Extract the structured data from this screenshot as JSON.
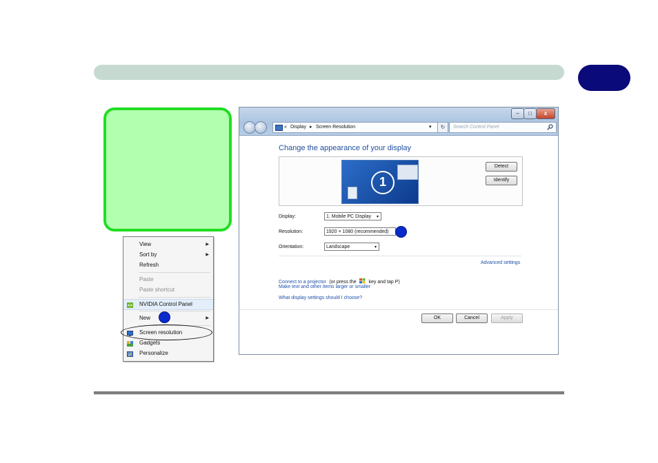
{
  "context_menu": {
    "items": [
      {
        "label": "View",
        "submenu": true,
        "disabled": false
      },
      {
        "label": "Sort by",
        "submenu": true,
        "disabled": false
      },
      {
        "label": "Refresh",
        "submenu": false,
        "disabled": false
      },
      {
        "label": "Paste",
        "submenu": false,
        "disabled": true
      },
      {
        "label": "Paste shortcut",
        "submenu": false,
        "disabled": true
      },
      {
        "label": "NVIDIA Control Panel",
        "submenu": false,
        "disabled": false,
        "icon": "nvidia-icon"
      },
      {
        "label": "New",
        "submenu": true,
        "disabled": false
      },
      {
        "label": "Screen resolution",
        "submenu": false,
        "disabled": false,
        "icon": "screen-resolution-icon"
      },
      {
        "label": "Gadgets",
        "submenu": false,
        "disabled": false,
        "icon": "gadgets-icon"
      },
      {
        "label": "Personalize",
        "submenu": false,
        "disabled": false,
        "icon": "personalize-icon"
      }
    ],
    "submenu_arrow": "▶"
  },
  "window": {
    "buttons": {
      "minimize": "–",
      "maximize": "□",
      "close": "x"
    },
    "address": {
      "chevron": "«",
      "crumb1": "Display",
      "sep": "▸",
      "crumb2": "Screen Resolution",
      "dropdown": "▾",
      "refresh": "↻"
    },
    "search": {
      "placeholder": "Search Control Panel",
      "icon": "search-icon"
    },
    "heading": "Change the appearance of your display",
    "monitor_number": "1",
    "detect_button": "Detect",
    "identify_button": "Identify",
    "display_label": "Display:",
    "display_value": "1. Mobile PC Display",
    "resolution_label": "Resolution:",
    "resolution_value": "1920 × 1080 (recommended)",
    "orientation_label": "Orientation:",
    "orientation_value": "Landscape",
    "advanced_link": "Advanced settings",
    "projector_link": "Connect to a projector",
    "projector_text_1": "(or press the",
    "projector_text_2": "key and tap P)",
    "text_size_link": "Make text and other items larger or smaller",
    "which_settings_link": "What display settings should I choose?",
    "ok_button": "OK",
    "cancel_button": "Cancel",
    "apply_button": "Apply"
  },
  "colors": {
    "header_bar": "#c6dad1",
    "chapter_pill": "#0a0a7a",
    "callout_fill": "#b3ffb0",
    "callout_border": "#22dd22",
    "marker": "#0a2acc",
    "link": "#1c4fa8"
  }
}
